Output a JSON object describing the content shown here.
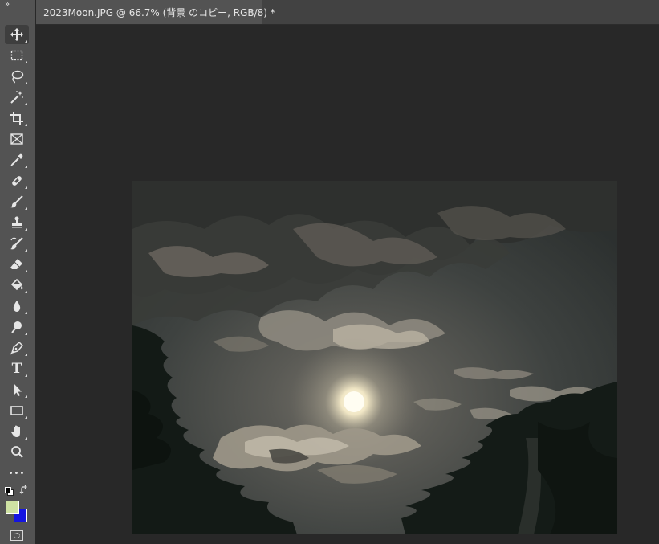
{
  "document_tab": {
    "title": "2023Moon.JPG @ 66.7% (背景 のコピー, RGB/8) *",
    "close_glyph": "×"
  },
  "toolbar": {
    "collapse_glyph": "»",
    "tools": [
      {
        "name": "move-tool",
        "icon": "move-icon"
      },
      {
        "name": "rectangular-marquee-tool",
        "icon": "marquee-icon"
      },
      {
        "name": "lasso-tool",
        "icon": "lasso-icon"
      },
      {
        "name": "magic-wand-tool",
        "icon": "magic-wand-icon"
      },
      {
        "name": "crop-tool",
        "icon": "crop-icon"
      },
      {
        "name": "frame-tool",
        "icon": "frame-icon"
      },
      {
        "name": "eyedropper-tool",
        "icon": "eyedropper-icon"
      },
      {
        "name": "healing-brush-tool",
        "icon": "bandage-icon"
      },
      {
        "name": "brush-tool",
        "icon": "brush-icon"
      },
      {
        "name": "clone-stamp-tool",
        "icon": "stamp-icon"
      },
      {
        "name": "history-brush-tool",
        "icon": "history-brush-icon"
      },
      {
        "name": "eraser-tool",
        "icon": "eraser-icon"
      },
      {
        "name": "paint-bucket-tool",
        "icon": "bucket-icon"
      },
      {
        "name": "blur-tool",
        "icon": "drop-icon"
      },
      {
        "name": "dodge-tool",
        "icon": "dodge-icon"
      },
      {
        "name": "pen-tool",
        "icon": "pen-icon"
      },
      {
        "name": "type-tool",
        "icon": "type-icon",
        "label": "T"
      },
      {
        "name": "path-selection-tool",
        "icon": "arrow-icon"
      },
      {
        "name": "rectangle-tool",
        "icon": "rectangle-icon"
      },
      {
        "name": "hand-tool",
        "icon": "hand-icon"
      },
      {
        "name": "zoom-tool",
        "icon": "magnifier-icon"
      },
      {
        "name": "edit-toolbar",
        "icon": "ellipsis-icon",
        "label": "•••"
      }
    ],
    "foreground_color": "#cfe2a3",
    "background_color": "#1414e0"
  },
  "colors": {
    "app_bg": "#282828",
    "toolbar_bg": "#535353",
    "tab_active_bg": "#535353"
  }
}
